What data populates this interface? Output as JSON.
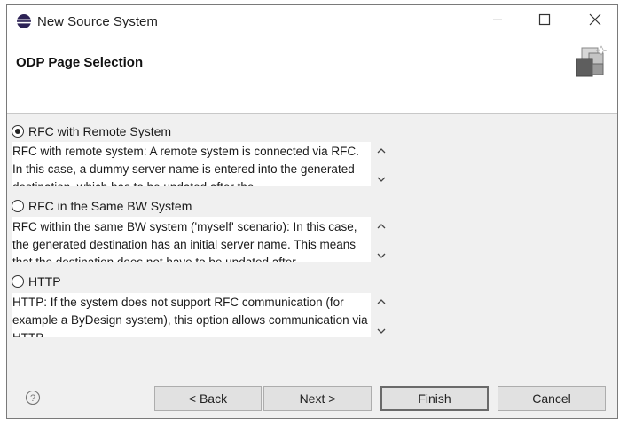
{
  "window": {
    "title": "New Source System",
    "icons": {
      "app": "eclipse-icon",
      "minimize": "minimize-icon",
      "maximize": "maximize-icon",
      "close": "close-icon"
    }
  },
  "header": {
    "title": "ODP Page Selection",
    "icon": "wizard-banner-icon"
  },
  "options": [
    {
      "label": "RFC with Remote System",
      "selected": true,
      "description": "RFC with remote system: A remote system is connected via RFC. In this case, a dummy server name is entered into the generated destination, which has to be updated after the"
    },
    {
      "label": "RFC in the Same BW System",
      "selected": false,
      "description": "RFC within the same BW system ('myself' scenario): In this case, the generated destination has an initial server name. This means that the destination does not have to be updated after"
    },
    {
      "label": "HTTP",
      "selected": false,
      "description": "HTTP: If the system does not support RFC communication (for example a ByDesign system), this option allows communication via HTTP."
    }
  ],
  "footer": {
    "help_icon": "help-icon",
    "back_label": "< Back",
    "next_label": "Next >",
    "finish_label": "Finish",
    "cancel_label": "Cancel"
  }
}
